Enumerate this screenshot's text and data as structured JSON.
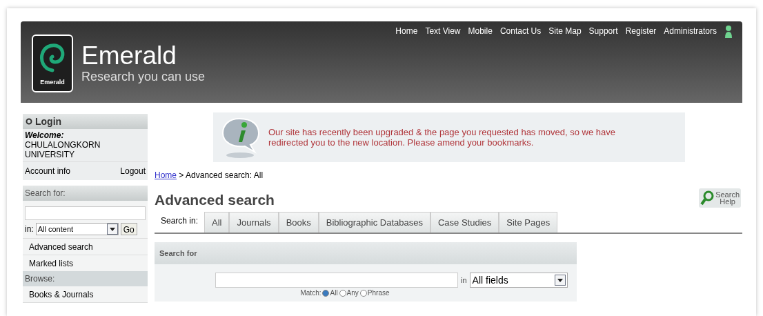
{
  "header": {
    "logo_label": "Emerald",
    "title": "Emerald",
    "tagline": "Research you can use",
    "nav": [
      "Home",
      "Text View",
      "Mobile",
      "Contact Us",
      "Site Map",
      "Support",
      "Register",
      "Administrators"
    ]
  },
  "sidebar": {
    "login": {
      "title": "Login",
      "welcome": "Welcome:",
      "user": "CHULALONGKORN UNIVERSITY",
      "account": "Account info",
      "logout": "Logout"
    },
    "search": {
      "title": "Search for:",
      "in_label": "in:",
      "scope": "All content",
      "go": "Go",
      "links": [
        "Advanced search",
        "Marked lists"
      ]
    },
    "browse": {
      "title": "Browse:",
      "links": [
        "Books & Journals"
      ]
    }
  },
  "notice": "Our site has recently been upgraded & the page you requested has moved, so we have redirected you to the new location. Please amend your bookmarks.",
  "breadcrumb": {
    "home": "Home",
    "rest": " > Advanced search: All"
  },
  "heading": "Advanced search",
  "help": [
    "Search",
    "Help"
  ],
  "tabs_label": "Search in:",
  "tabs": [
    {
      "label": "All",
      "selected": false
    },
    {
      "label": "Journals",
      "selected": false
    },
    {
      "label": "Books",
      "selected": false
    },
    {
      "label": "Bibliographic Databases",
      "selected": false
    },
    {
      "label": "Case Studies",
      "selected": false
    },
    {
      "label": "Site Pages",
      "selected": false
    }
  ],
  "panel": {
    "title": "Search for",
    "in_label": "in",
    "field": "All fields",
    "match_label": "Match:",
    "match": [
      {
        "label": "All",
        "selected": true
      },
      {
        "label": "Any",
        "selected": false
      },
      {
        "label": "Phrase",
        "selected": false
      }
    ]
  }
}
